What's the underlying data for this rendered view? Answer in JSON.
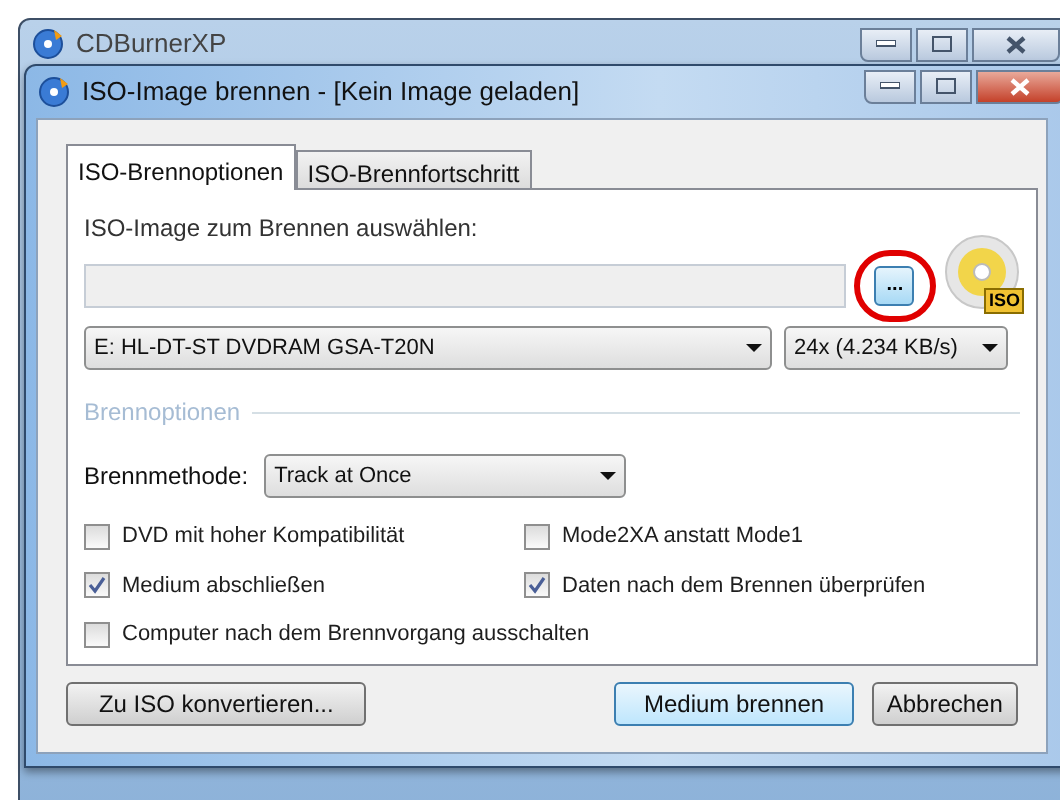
{
  "main_window": {
    "title": "CDBurnerXP"
  },
  "dialog": {
    "title": "ISO-Image brennen - [Kein Image geladen]",
    "tabs": [
      {
        "label": "ISO-Brennoptionen",
        "selected": true
      },
      {
        "label": "ISO-Brennfortschritt",
        "selected": false
      }
    ],
    "image_label": "ISO-Image zum Brennen auswählen:",
    "browse_button": "...",
    "iso_badge": "ISO",
    "drive": "E: HL-DT-ST DVDRAM GSA-T20N",
    "speed": "24x (4.234 KB/s)",
    "group_title": "Brennoptionen",
    "method_label": "Brennmethode:",
    "method": "Track at Once",
    "options": [
      {
        "label": "DVD mit hoher Kompatibilität",
        "checked": false
      },
      {
        "label": "Mode2XA anstatt Mode1",
        "checked": false
      },
      {
        "label": "Medium abschließen",
        "checked": true
      },
      {
        "label": "Daten nach dem Brennen überprüfen",
        "checked": true
      },
      {
        "label": "Computer nach dem Brennvorgang ausschalten",
        "checked": false
      }
    ],
    "buttons": [
      {
        "label": "Zu ISO konvertieren...",
        "kind": "secondary"
      },
      {
        "label": "Medium brennen",
        "kind": "default"
      },
      {
        "label": "Abbrechen",
        "kind": "secondary"
      }
    ]
  }
}
